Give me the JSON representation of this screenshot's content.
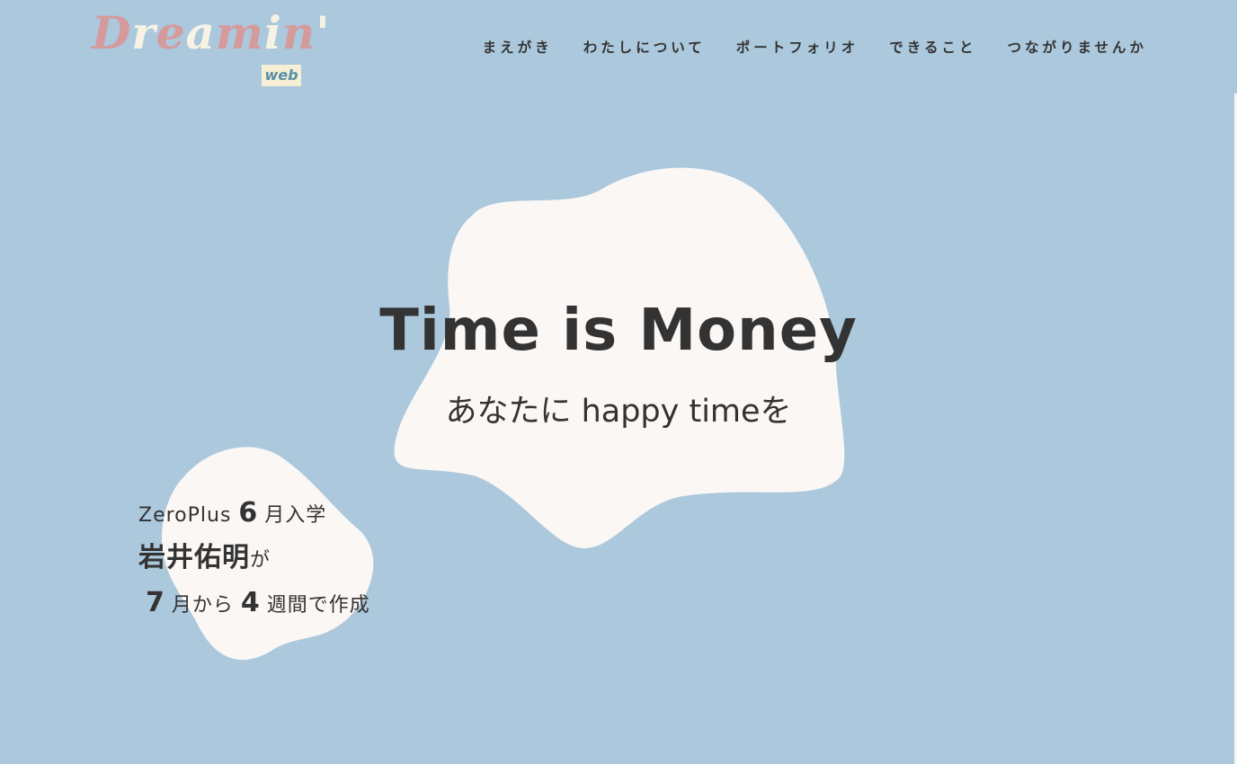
{
  "header": {
    "logo": {
      "word": "Dreamin'",
      "letters": [
        {
          "ch": "D",
          "color": "#d59a9c"
        },
        {
          "ch": "r",
          "color": "#f7f3e4"
        },
        {
          "ch": "e",
          "color": "#d59a9c"
        },
        {
          "ch": "a",
          "color": "#f7f3e4"
        },
        {
          "ch": "m",
          "color": "#d59a9c"
        },
        {
          "ch": "i",
          "color": "#f7f3e4"
        },
        {
          "ch": "n",
          "color": "#d59a9c"
        },
        {
          "ch": "'",
          "color": "#f7f3e4"
        }
      ],
      "sub": "web"
    },
    "nav": [
      {
        "label": "まえがき"
      },
      {
        "label": "わたしについて"
      },
      {
        "label": "ポートフォリオ"
      },
      {
        "label": "できること"
      },
      {
        "label": "つながりませんか"
      }
    ]
  },
  "hero": {
    "title": "Time is Money",
    "subtitle": "あなたに happy timeを"
  },
  "credit": {
    "school": "ZeroPlus",
    "month_join": "6",
    "join_suffix": "月入学",
    "name": "岩井佑明",
    "name_particle": "が",
    "month_start": "7",
    "start_suffix": "月から",
    "weeks": "4",
    "weeks_suffix": "週間で作成"
  },
  "colors": {
    "background": "#abc8dd",
    "blob": "#fbf7f4",
    "text": "#333333",
    "logo_pink": "#d59a9c",
    "logo_cream": "#f7f3e4"
  }
}
